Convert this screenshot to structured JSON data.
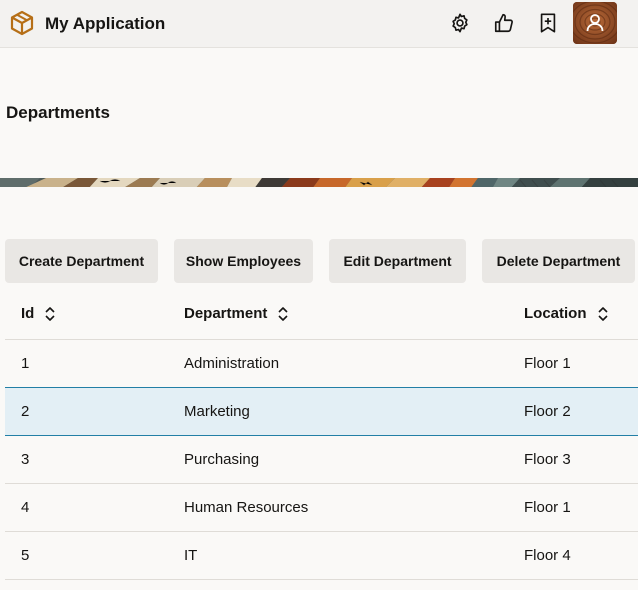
{
  "header": {
    "app_title": "My Application",
    "icons": [
      "gear-icon",
      "thumbs-up-icon",
      "bookmark-add-icon",
      "user-icon"
    ]
  },
  "page": {
    "title": "Departments"
  },
  "toolbar": {
    "create_label": "Create Department",
    "show_label": "Show Employees",
    "edit_label": "Edit Department",
    "delete_label": "Delete Department"
  },
  "table": {
    "columns": [
      "Id",
      "Department",
      "Location"
    ],
    "rows": [
      {
        "id": "1",
        "department": "Administration",
        "location": "Floor 1"
      },
      {
        "id": "2",
        "department": "Marketing",
        "location": "Floor 2"
      },
      {
        "id": "3",
        "department": "Purchasing",
        "location": "Floor 3"
      },
      {
        "id": "4",
        "department": "Human Resources",
        "location": "Floor 1"
      },
      {
        "id": "5",
        "department": "IT",
        "location": "Floor 4"
      }
    ],
    "selected_row_index": 1
  },
  "colors": {
    "accent": "#227fa6",
    "selected_row_bg": "#e3eff5",
    "logo": "#c47e1f",
    "avatar": "#8a4a24"
  }
}
